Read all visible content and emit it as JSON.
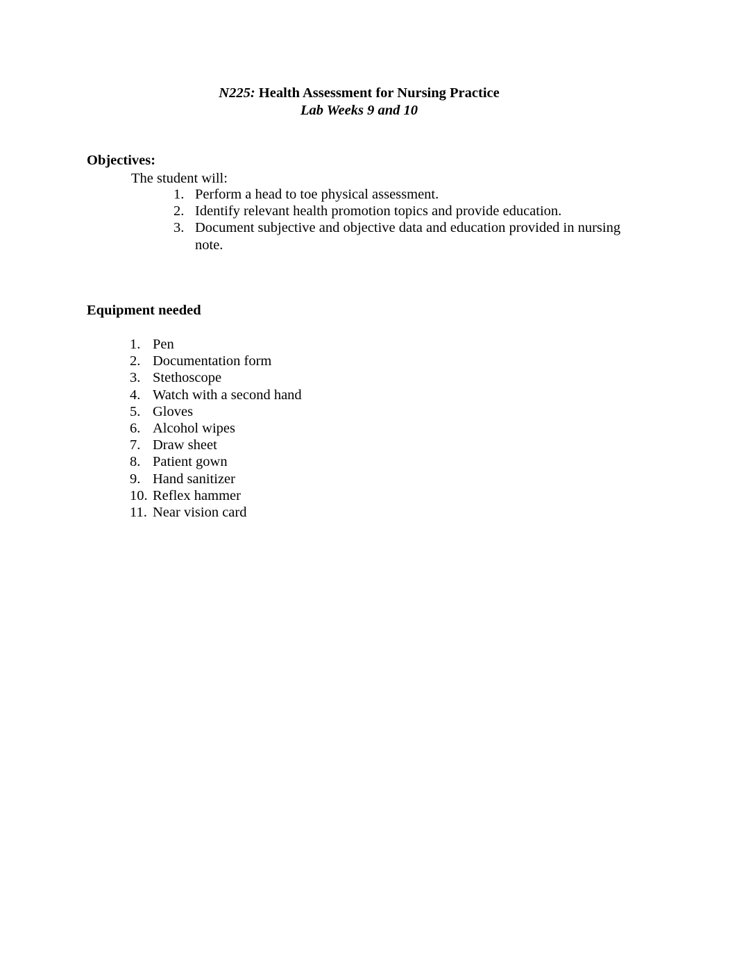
{
  "document": {
    "title_line_1_course_code": "N225:",
    "title_line_1_course_name": "Health Assessment for Nursing Practice",
    "title_line_2": "Lab Weeks 9 and 10"
  },
  "objectives": {
    "heading": "Objectives:",
    "lead_in": "The student will:",
    "items": [
      {
        "number": "1.",
        "text": "Perform a head to toe physical assessment."
      },
      {
        "number": "2.",
        "text": "Identify relevant health promotion topics and provide education."
      },
      {
        "number": "3.",
        "text": "Document subjective and objective data and education provided in nursing note."
      }
    ]
  },
  "equipment": {
    "heading": "Equipment needed",
    "items": [
      {
        "number": "1.",
        "text": "Pen"
      },
      {
        "number": "2.",
        "text": "Documentation form"
      },
      {
        "number": "3.",
        "text": "Stethoscope"
      },
      {
        "number": "4.",
        "text": "Watch with a second hand"
      },
      {
        "number": "5.",
        "text": "Gloves"
      },
      {
        "number": "6.",
        "text": "Alcohol wipes"
      },
      {
        "number": "7.",
        "text": "Draw sheet"
      },
      {
        "number": "8.",
        "text": "Patient gown"
      },
      {
        "number": "9.",
        "text": "Hand sanitizer"
      },
      {
        "number": "10.",
        "text": "Reflex hammer"
      },
      {
        "number": "11.",
        "text": "Near vision card"
      }
    ]
  },
  "colors": {
    "page_background": "#ffffff",
    "text": "#000000"
  }
}
